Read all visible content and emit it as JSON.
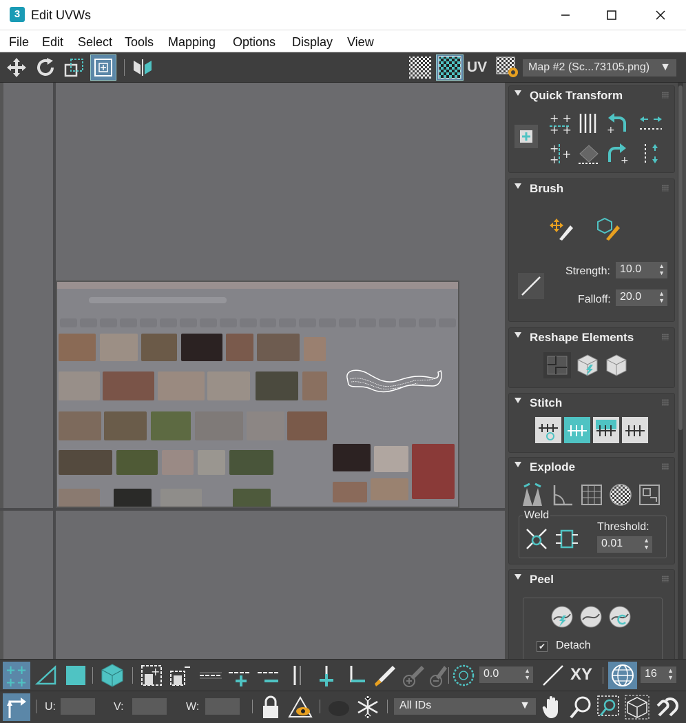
{
  "window": {
    "title": "Edit UVWs",
    "app_icon": "3"
  },
  "menu": [
    "File",
    "Edit",
    "Select",
    "Tools",
    "Mapping",
    "Options",
    "Display",
    "View"
  ],
  "toolbar": {
    "uv_label": "UV",
    "map_select": "Map #2 (Sc...73105.png)"
  },
  "rollouts": {
    "quick_transform": {
      "title": "Quick Transform"
    },
    "brush": {
      "title": "Brush",
      "strength_label": "Strength:",
      "strength_value": "10.0",
      "falloff_label": "Falloff:",
      "falloff_value": "20.0"
    },
    "reshape": {
      "title": "Reshape Elements"
    },
    "stitch": {
      "title": "Stitch"
    },
    "explode": {
      "title": "Explode",
      "weld_label": "Weld",
      "threshold_label": "Threshold:",
      "threshold_value": "0.01"
    },
    "peel": {
      "title": "Peel",
      "detach_label": "Detach",
      "detach_checked": true
    }
  },
  "bottom_toolbar": {
    "angle_value": "0.0",
    "xy_label": "XY",
    "grid_value": "16",
    "u_label": "U:",
    "v_label": "V:",
    "w_label": "W:",
    "ids_select": "All IDs"
  },
  "colors": {
    "accent": "#4fc3c3",
    "panel": "#434343",
    "viewport": "#6b6b6e"
  }
}
